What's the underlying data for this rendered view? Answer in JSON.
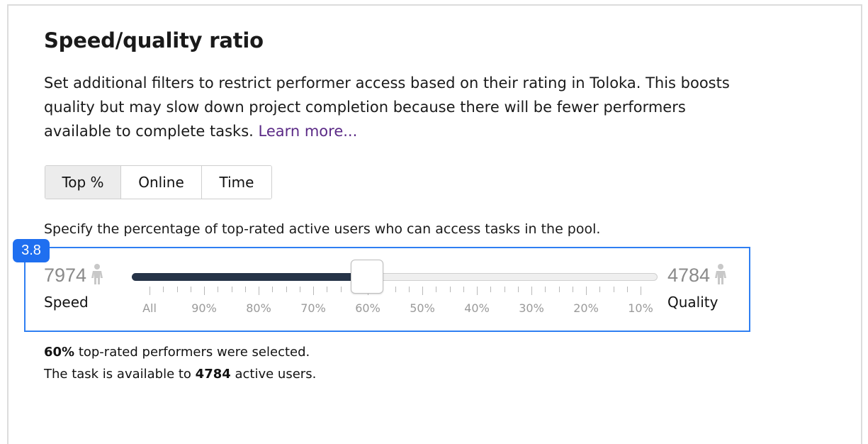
{
  "title": "Speed/quality ratio",
  "description": {
    "text": "Set additional filters to restrict performer access based on their rating in Toloka. This boosts quality but may slow down project completion because there will be fewer performers available to complete tasks. ",
    "link": "Learn more..."
  },
  "tabs": [
    {
      "label": "Top %",
      "active": true
    },
    {
      "label": "Online",
      "active": false
    },
    {
      "label": "Time",
      "active": false
    }
  ],
  "hint": "Specify the percentage of top-rated active users who can access tasks in the pool.",
  "badge": "3.8",
  "slider": {
    "left_count": "7974",
    "left_label": "Speed",
    "right_count": "4784",
    "right_label": "Quality",
    "selected_percent": 60,
    "tick_labels": [
      "All",
      "90%",
      "80%",
      "70%",
      "60%",
      "50%",
      "40%",
      "30%",
      "20%",
      "10%"
    ],
    "icon": "person-icon",
    "fill_color": "#263448"
  },
  "summary": {
    "line1_value": "60%",
    "line1_text": " top-rated performers were selected.",
    "line2_prefix": "The task is available to ",
    "line2_value": "4784",
    "line2_suffix": " active users."
  },
  "colors": {
    "accent": "#2f7ff2",
    "link": "#5b2a86",
    "badge": "#1f6ff0"
  }
}
